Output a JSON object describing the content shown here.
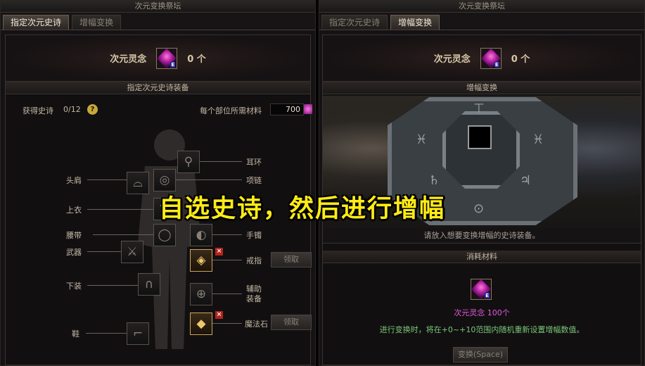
{
  "left": {
    "window_title": "次元变换祭坛",
    "tabs": [
      {
        "label": "指定次元史诗",
        "active": true
      },
      {
        "label": "增幅变换",
        "active": false
      }
    ],
    "currency": {
      "label": "次元灵念",
      "count": "0 个",
      "icon": "dimension-spirit-gem-icon"
    },
    "section_title": "指定次元史诗装备",
    "acquired_label": "获得史诗",
    "acquired_count": "0/12",
    "material_label": "每个部位所需材料",
    "material_value": "700",
    "slots": {
      "earring": "耳环",
      "necklace": "项链",
      "shoulder": "头肩",
      "top": "上衣",
      "belt": "腰带",
      "bracelet": "手镯",
      "weapon": "武器",
      "ring": "戒指",
      "pants": "下装",
      "support": "辅助\n装备",
      "shoes": "鞋",
      "magic_stone": "魔法石"
    },
    "claim_label": "领取"
  },
  "right": {
    "window_title": "次元变换祭坛",
    "tabs": [
      {
        "label": "指定次元史诗",
        "active": false
      },
      {
        "label": "增幅变换",
        "active": true
      }
    ],
    "currency": {
      "label": "次元灵念",
      "count": "0 个",
      "icon": "dimension-spirit-gem-icon"
    },
    "section_title": "增幅变换",
    "hint": "请放入想要变换增幅的史诗装备。",
    "cost_title": "消耗材料",
    "cost_item": "次元灵念 100个",
    "cost_desc": "进行变换时，将在+0~+10范围内随机重新设置增幅数值。",
    "swap_button": "变换(Space)"
  },
  "overlay_caption": "自选史诗，然后进行增幅",
  "colors": {
    "caption": "#ffec15",
    "cost_item": "#e25bdc",
    "cost_desc": "#78c878"
  }
}
